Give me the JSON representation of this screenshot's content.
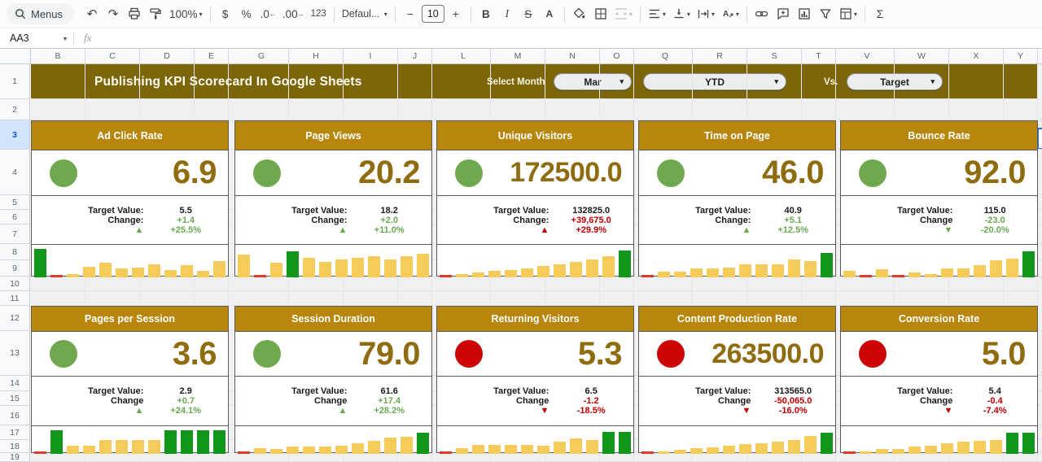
{
  "toolbar": {
    "menus_label": "Menus",
    "zoom_value": "100%",
    "dollar": "$",
    "percent": "%",
    "decrease_decimal": ".0",
    "increase_decimal": ".00",
    "number_format": "123",
    "font_name": "Defaul...",
    "font_size_minus": "−",
    "font_size": "10",
    "font_size_plus": "+",
    "bold": "B",
    "italic": "I",
    "strikethrough": "S",
    "text_color": "A",
    "functions_sigma": "Σ"
  },
  "icons": {
    "undo": "↶",
    "redo": "↷",
    "dropdown": "▾",
    "up": "▲",
    "down": "▼",
    "dec_arrow": "←",
    "inc_arrow": "→"
  },
  "formula_bar": {
    "cell_ref": "AA3",
    "fx": "fx"
  },
  "sheet": {
    "column_letters": [
      "B",
      "C",
      "D",
      "E",
      "G",
      "H",
      "I",
      "J",
      "L",
      "M",
      "N",
      "O",
      "Q",
      "R",
      "S",
      "T",
      "V",
      "W",
      "X",
      "Y"
    ],
    "row_numbers": [
      "1",
      "2",
      "3",
      "4",
      "5",
      "6",
      "7",
      "8",
      "9",
      "10",
      "11",
      "12",
      "13",
      "14",
      "15",
      "16",
      "17",
      "18",
      "19"
    ],
    "selected_row": "3",
    "selected_cell": "AA3"
  },
  "banner": {
    "title": "Publishing KPI Scorecard In Google Sheets",
    "select_month_label": "Select Month",
    "month_value": "Mar",
    "period_value": "YTD",
    "vs_label": "Vs.",
    "compare_value": "Target"
  },
  "colors": {
    "banner_bg": "#7d660a",
    "card_header_bg": "#b8860b",
    "value_text": "#8f6c10",
    "green_text": "#6aa84f",
    "red_text": "#c00000",
    "dot_green": "#6fa84f",
    "dot_red": "#cc0606",
    "bar_gold": "#f5cb5a",
    "bar_green": "#109618",
    "bar_red": "#e03b2f",
    "selection_blue": "#1a73e8"
  },
  "cards": [
    {
      "title": "Ad Click Rate",
      "status": "green",
      "value": "6.9",
      "target_label": "Target Value:",
      "target": "5.5",
      "change_label": "Change:",
      "change": "+1.4",
      "change_color": "green",
      "dir": "up",
      "dir_color": "green",
      "pct": "+25.5%",
      "pct_color": "green",
      "bars": [
        [
          1.0,
          "green"
        ],
        [
          0.05,
          "red"
        ],
        [
          0.12,
          "gold"
        ],
        [
          0.38,
          "gold"
        ],
        [
          0.52,
          "gold"
        ],
        [
          0.3,
          "gold"
        ],
        [
          0.33,
          "gold"
        ],
        [
          0.45,
          "gold"
        ],
        [
          0.27,
          "gold"
        ],
        [
          0.42,
          "gold"
        ],
        [
          0.24,
          "gold"
        ],
        [
          0.58,
          "gold"
        ]
      ]
    },
    {
      "title": "Page Views",
      "status": "green",
      "value": "20.2",
      "target_label": "Target Value:",
      "target": "18.2",
      "change_label": "Change:",
      "change": "+2.0",
      "change_color": "green",
      "dir": "up",
      "dir_color": "green",
      "pct": "+11.0%",
      "pct_color": "green",
      "bars": [
        [
          0.8,
          "gold"
        ],
        [
          0.05,
          "red"
        ],
        [
          0.5,
          "gold"
        ],
        [
          0.92,
          "green"
        ],
        [
          0.68,
          "gold"
        ],
        [
          0.55,
          "gold"
        ],
        [
          0.62,
          "gold"
        ],
        [
          0.68,
          "gold"
        ],
        [
          0.74,
          "gold"
        ],
        [
          0.62,
          "gold"
        ],
        [
          0.74,
          "gold"
        ],
        [
          0.84,
          "gold"
        ]
      ]
    },
    {
      "title": "Unique Visitors",
      "status": "green",
      "value": "172500.0",
      "target_label": "Target Value:",
      "target": "132825.0",
      "change_label": "Change:",
      "change": "+39,675.0",
      "change_color": "red",
      "dir": "up",
      "dir_color": "red",
      "pct": "+29.9%",
      "pct_color": "red",
      "bars": [
        [
          0.05,
          "red"
        ],
        [
          0.1,
          "gold"
        ],
        [
          0.16,
          "gold"
        ],
        [
          0.22,
          "gold"
        ],
        [
          0.26,
          "gold"
        ],
        [
          0.32,
          "gold"
        ],
        [
          0.4,
          "gold"
        ],
        [
          0.47,
          "gold"
        ],
        [
          0.55,
          "gold"
        ],
        [
          0.64,
          "gold"
        ],
        [
          0.75,
          "gold"
        ],
        [
          0.95,
          "green"
        ]
      ]
    },
    {
      "title": "Time on Page",
      "status": "green",
      "value": "46.0",
      "target_label": "Target Value:",
      "target": "40.9",
      "change_label": "Change:",
      "change": "+5.1",
      "change_color": "green",
      "dir": "up",
      "dir_color": "green",
      "pct": "+12.5%",
      "pct_color": "green",
      "bars": [
        [
          0.05,
          "red"
        ],
        [
          0.2,
          "gold"
        ],
        [
          0.2,
          "gold"
        ],
        [
          0.32,
          "gold"
        ],
        [
          0.3,
          "gold"
        ],
        [
          0.35,
          "gold"
        ],
        [
          0.45,
          "gold"
        ],
        [
          0.45,
          "gold"
        ],
        [
          0.45,
          "gold"
        ],
        [
          0.62,
          "gold"
        ],
        [
          0.56,
          "gold"
        ],
        [
          0.85,
          "green"
        ]
      ]
    },
    {
      "title": "Bounce Rate",
      "status": "green",
      "value": "92.0",
      "target_label": "Target Value:",
      "target": "115.0",
      "change_label": "Change",
      "change": "-23.0",
      "change_color": "green",
      "dir": "down",
      "dir_color": "green",
      "pct": "-20.0%",
      "pct_color": "green",
      "bars": [
        [
          0.22,
          "gold"
        ],
        [
          0.05,
          "red"
        ],
        [
          0.28,
          "gold"
        ],
        [
          0.05,
          "red"
        ],
        [
          0.16,
          "gold"
        ],
        [
          0.12,
          "gold"
        ],
        [
          0.3,
          "gold"
        ],
        [
          0.3,
          "gold"
        ],
        [
          0.42,
          "gold"
        ],
        [
          0.6,
          "gold"
        ],
        [
          0.65,
          "gold"
        ],
        [
          0.92,
          "green"
        ]
      ]
    },
    {
      "title": "Pages per Session",
      "status": "green",
      "value": "3.6",
      "target_label": "Target Value:",
      "target": "2.9",
      "change_label": "Change",
      "change": "+0.7",
      "change_color": "green",
      "dir": "up",
      "dir_color": "green",
      "pct": "+24.1%",
      "pct_color": "green",
      "bars": [
        [
          0.05,
          "red"
        ],
        [
          1.0,
          "green"
        ],
        [
          0.35,
          "gold"
        ],
        [
          0.35,
          "gold"
        ],
        [
          0.6,
          "gold"
        ],
        [
          0.6,
          "gold"
        ],
        [
          0.6,
          "gold"
        ],
        [
          0.6,
          "gold"
        ],
        [
          1.0,
          "green"
        ],
        [
          1.0,
          "green"
        ],
        [
          1.0,
          "green"
        ],
        [
          1.0,
          "green"
        ]
      ]
    },
    {
      "title": "Session Duration",
      "status": "green",
      "value": "79.0",
      "target_label": "Target Value:",
      "target": "61.6",
      "change_label": "Change",
      "change": "+17.4",
      "change_color": "green",
      "dir": "up",
      "dir_color": "green",
      "pct": "+28.2%",
      "pct_color": "green",
      "bars": [
        [
          0.05,
          "red"
        ],
        [
          0.25,
          "gold"
        ],
        [
          0.2,
          "gold"
        ],
        [
          0.32,
          "gold"
        ],
        [
          0.32,
          "gold"
        ],
        [
          0.32,
          "gold"
        ],
        [
          0.36,
          "gold"
        ],
        [
          0.46,
          "gold"
        ],
        [
          0.56,
          "gold"
        ],
        [
          0.68,
          "gold"
        ],
        [
          0.74,
          "gold"
        ],
        [
          0.88,
          "green"
        ]
      ]
    },
    {
      "title": "Returning Visitors",
      "status": "red",
      "value": "5.3",
      "target_label": "Target Value:",
      "target": "6.5",
      "change_label": "Change",
      "change": "-1.2",
      "change_color": "red",
      "dir": "down",
      "dir_color": "red",
      "pct": "-18.5%",
      "pct_color": "red",
      "bars": [
        [
          0.05,
          "red"
        ],
        [
          0.25,
          "gold"
        ],
        [
          0.38,
          "gold"
        ],
        [
          0.38,
          "gold"
        ],
        [
          0.38,
          "gold"
        ],
        [
          0.38,
          "gold"
        ],
        [
          0.36,
          "gold"
        ],
        [
          0.5,
          "gold"
        ],
        [
          0.66,
          "gold"
        ],
        [
          0.58,
          "gold"
        ],
        [
          0.92,
          "green"
        ],
        [
          0.92,
          "green"
        ]
      ]
    },
    {
      "title": "Content Production Rate",
      "status": "red",
      "value": "263500.0",
      "target_label": "Target Value:",
      "target": "313565.0",
      "change_label": "Change",
      "change": "-50,065.0",
      "change_color": "red",
      "dir": "down",
      "dir_color": "red",
      "pct": "-16.0%",
      "pct_color": "red",
      "bars": [
        [
          0.05,
          "red"
        ],
        [
          0.12,
          "gold"
        ],
        [
          0.18,
          "gold"
        ],
        [
          0.25,
          "gold"
        ],
        [
          0.28,
          "gold"
        ],
        [
          0.34,
          "gold"
        ],
        [
          0.4,
          "gold"
        ],
        [
          0.46,
          "gold"
        ],
        [
          0.52,
          "gold"
        ],
        [
          0.6,
          "gold"
        ],
        [
          0.76,
          "gold"
        ],
        [
          0.9,
          "green"
        ]
      ]
    },
    {
      "title": "Conversion Rate",
      "status": "red",
      "value": "5.0",
      "target_label": "Target Value:",
      "target": "5.4",
      "change_label": "Change",
      "change": "-0.4",
      "change_color": "red",
      "dir": "down",
      "dir_color": "red",
      "pct": "-7.4%",
      "pct_color": "red",
      "bars": [
        [
          0.05,
          "red"
        ],
        [
          0.1,
          "gold"
        ],
        [
          0.22,
          "gold"
        ],
        [
          0.2,
          "gold"
        ],
        [
          0.3,
          "gold"
        ],
        [
          0.35,
          "gold"
        ],
        [
          0.45,
          "gold"
        ],
        [
          0.5,
          "gold"
        ],
        [
          0.55,
          "gold"
        ],
        [
          0.6,
          "gold"
        ],
        [
          0.88,
          "green"
        ],
        [
          0.88,
          "green"
        ]
      ]
    }
  ]
}
